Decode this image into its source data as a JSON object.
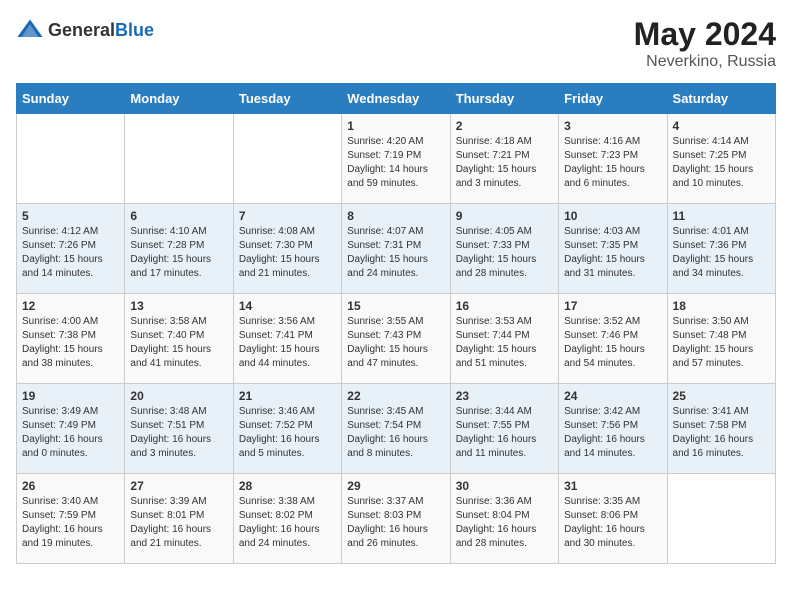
{
  "logo": {
    "text_general": "General",
    "text_blue": "Blue"
  },
  "title": {
    "month_year": "May 2024",
    "location": "Neverkino, Russia"
  },
  "weekdays": [
    "Sunday",
    "Monday",
    "Tuesday",
    "Wednesday",
    "Thursday",
    "Friday",
    "Saturday"
  ],
  "weeks": [
    [
      {
        "day": "",
        "info": ""
      },
      {
        "day": "",
        "info": ""
      },
      {
        "day": "",
        "info": ""
      },
      {
        "day": "1",
        "info": "Sunrise: 4:20 AM\nSunset: 7:19 PM\nDaylight: 14 hours\nand 59 minutes."
      },
      {
        "day": "2",
        "info": "Sunrise: 4:18 AM\nSunset: 7:21 PM\nDaylight: 15 hours\nand 3 minutes."
      },
      {
        "day": "3",
        "info": "Sunrise: 4:16 AM\nSunset: 7:23 PM\nDaylight: 15 hours\nand 6 minutes."
      },
      {
        "day": "4",
        "info": "Sunrise: 4:14 AM\nSunset: 7:25 PM\nDaylight: 15 hours\nand 10 minutes."
      }
    ],
    [
      {
        "day": "5",
        "info": "Sunrise: 4:12 AM\nSunset: 7:26 PM\nDaylight: 15 hours\nand 14 minutes."
      },
      {
        "day": "6",
        "info": "Sunrise: 4:10 AM\nSunset: 7:28 PM\nDaylight: 15 hours\nand 17 minutes."
      },
      {
        "day": "7",
        "info": "Sunrise: 4:08 AM\nSunset: 7:30 PM\nDaylight: 15 hours\nand 21 minutes."
      },
      {
        "day": "8",
        "info": "Sunrise: 4:07 AM\nSunset: 7:31 PM\nDaylight: 15 hours\nand 24 minutes."
      },
      {
        "day": "9",
        "info": "Sunrise: 4:05 AM\nSunset: 7:33 PM\nDaylight: 15 hours\nand 28 minutes."
      },
      {
        "day": "10",
        "info": "Sunrise: 4:03 AM\nSunset: 7:35 PM\nDaylight: 15 hours\nand 31 minutes."
      },
      {
        "day": "11",
        "info": "Sunrise: 4:01 AM\nSunset: 7:36 PM\nDaylight: 15 hours\nand 34 minutes."
      }
    ],
    [
      {
        "day": "12",
        "info": "Sunrise: 4:00 AM\nSunset: 7:38 PM\nDaylight: 15 hours\nand 38 minutes."
      },
      {
        "day": "13",
        "info": "Sunrise: 3:58 AM\nSunset: 7:40 PM\nDaylight: 15 hours\nand 41 minutes."
      },
      {
        "day": "14",
        "info": "Sunrise: 3:56 AM\nSunset: 7:41 PM\nDaylight: 15 hours\nand 44 minutes."
      },
      {
        "day": "15",
        "info": "Sunrise: 3:55 AM\nSunset: 7:43 PM\nDaylight: 15 hours\nand 47 minutes."
      },
      {
        "day": "16",
        "info": "Sunrise: 3:53 AM\nSunset: 7:44 PM\nDaylight: 15 hours\nand 51 minutes."
      },
      {
        "day": "17",
        "info": "Sunrise: 3:52 AM\nSunset: 7:46 PM\nDaylight: 15 hours\nand 54 minutes."
      },
      {
        "day": "18",
        "info": "Sunrise: 3:50 AM\nSunset: 7:48 PM\nDaylight: 15 hours\nand 57 minutes."
      }
    ],
    [
      {
        "day": "19",
        "info": "Sunrise: 3:49 AM\nSunset: 7:49 PM\nDaylight: 16 hours\nand 0 minutes."
      },
      {
        "day": "20",
        "info": "Sunrise: 3:48 AM\nSunset: 7:51 PM\nDaylight: 16 hours\nand 3 minutes."
      },
      {
        "day": "21",
        "info": "Sunrise: 3:46 AM\nSunset: 7:52 PM\nDaylight: 16 hours\nand 5 minutes."
      },
      {
        "day": "22",
        "info": "Sunrise: 3:45 AM\nSunset: 7:54 PM\nDaylight: 16 hours\nand 8 minutes."
      },
      {
        "day": "23",
        "info": "Sunrise: 3:44 AM\nSunset: 7:55 PM\nDaylight: 16 hours\nand 11 minutes."
      },
      {
        "day": "24",
        "info": "Sunrise: 3:42 AM\nSunset: 7:56 PM\nDaylight: 16 hours\nand 14 minutes."
      },
      {
        "day": "25",
        "info": "Sunrise: 3:41 AM\nSunset: 7:58 PM\nDaylight: 16 hours\nand 16 minutes."
      }
    ],
    [
      {
        "day": "26",
        "info": "Sunrise: 3:40 AM\nSunset: 7:59 PM\nDaylight: 16 hours\nand 19 minutes."
      },
      {
        "day": "27",
        "info": "Sunrise: 3:39 AM\nSunset: 8:01 PM\nDaylight: 16 hours\nand 21 minutes."
      },
      {
        "day": "28",
        "info": "Sunrise: 3:38 AM\nSunset: 8:02 PM\nDaylight: 16 hours\nand 24 minutes."
      },
      {
        "day": "29",
        "info": "Sunrise: 3:37 AM\nSunset: 8:03 PM\nDaylight: 16 hours\nand 26 minutes."
      },
      {
        "day": "30",
        "info": "Sunrise: 3:36 AM\nSunset: 8:04 PM\nDaylight: 16 hours\nand 28 minutes."
      },
      {
        "day": "31",
        "info": "Sunrise: 3:35 AM\nSunset: 8:06 PM\nDaylight: 16 hours\nand 30 minutes."
      },
      {
        "day": "",
        "info": ""
      }
    ]
  ]
}
